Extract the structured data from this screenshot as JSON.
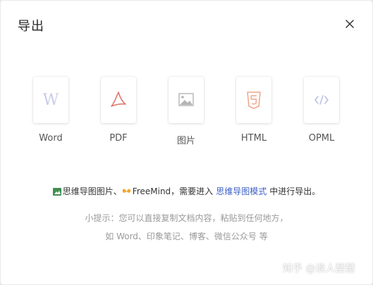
{
  "dialog": {
    "title": "导出",
    "close_icon": "close-icon"
  },
  "formats": [
    {
      "label": "Word",
      "icon": "word-icon",
      "color": "#c9cbe6"
    },
    {
      "label": "PDF",
      "icon": "pdf-icon",
      "color": "#e07b72"
    },
    {
      "label": "图片",
      "icon": "image-icon",
      "color": "#b5b5b5"
    },
    {
      "label": "HTML",
      "icon": "html5-icon",
      "color": "#f0a68b"
    },
    {
      "label": "OPML",
      "icon": "code-icon",
      "color": "#b9bde8"
    }
  ],
  "info": {
    "mindmap_image": "思维导图图片、",
    "freemind": "FreeMind，需要进入",
    "mindmap_mode_link": "思维导图模式",
    "suffix": "中进行导出。"
  },
  "tip": {
    "line1": "小提示：您可以直接复制文档内容，粘贴到任何地方，",
    "line2": "如 Word、印象笔记、博客、微信公众号 等"
  },
  "watermark": "知乎 @浪人琵琶",
  "colors": {
    "link": "#3b5ec6",
    "image_badge": "#3f8f4f",
    "freemind_badge": "#f5a623"
  }
}
